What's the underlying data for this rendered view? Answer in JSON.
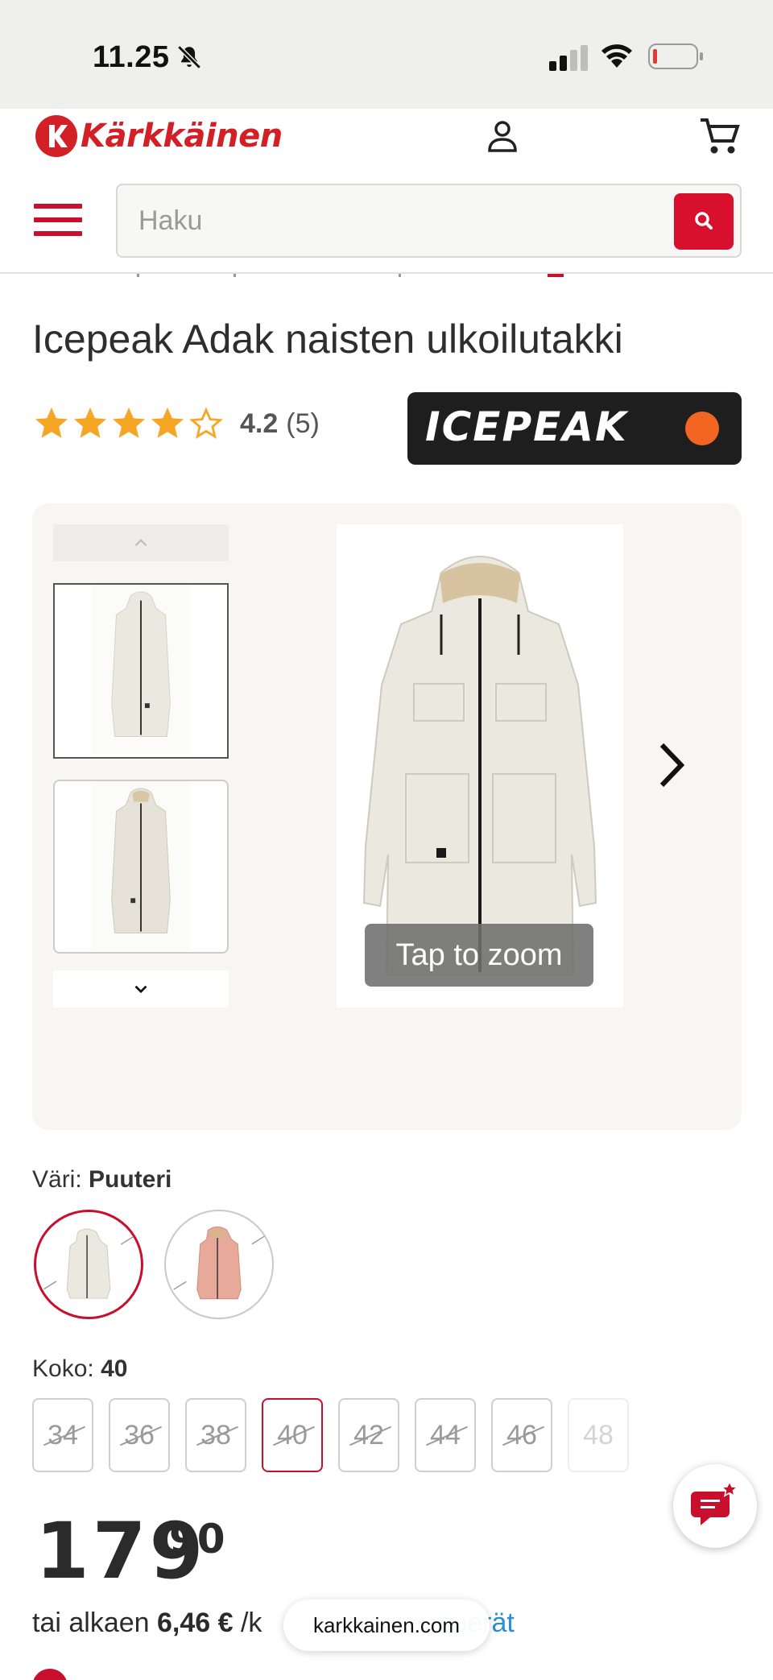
{
  "status_bar": {
    "time": "11.25"
  },
  "header": {
    "logo_text": "Kärkkäinen",
    "search_placeholder": "Haku"
  },
  "product": {
    "title": "Icepeak Adak naisten ulkoilutakki",
    "rating_value": "4.2",
    "rating_count": "(5)",
    "rating_stars": 4.2,
    "brand_logo_text": "ICEPEAK",
    "brand_colors": {
      "badge": "#1e1e1e",
      "dot": "#f26522"
    }
  },
  "gallery": {
    "zoom_hint": "Tap to zoom"
  },
  "color": {
    "label": "Väri:",
    "selected": "Puuteri"
  },
  "size": {
    "label": "Koko:",
    "selected": "40",
    "options": [
      "34",
      "36",
      "38",
      "40",
      "42",
      "44",
      "46",
      "48"
    ]
  },
  "price": {
    "euros": "179",
    "cents": "90",
    "installment_prefix": "tai alkaen",
    "installment_amount": "6,46 €",
    "installment_suffix": "/k",
    "installment_link": "suerät"
  },
  "browser": {
    "url": "karkkainen.com"
  },
  "colors": {
    "brand_red": "#c8102e",
    "link_blue": "#2a8fd0"
  }
}
